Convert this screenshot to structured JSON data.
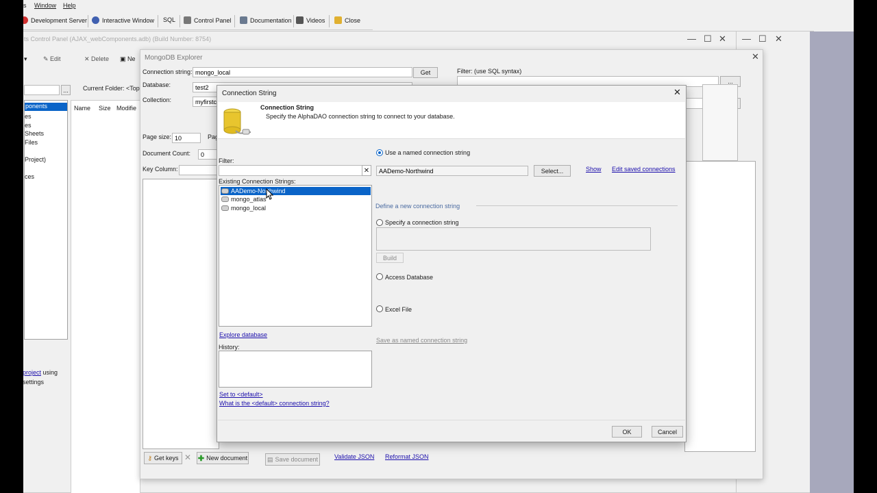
{
  "menubar": {
    "file_stub": "s",
    "window": "Window",
    "help": "Help"
  },
  "toolbar": {
    "items": [
      {
        "label": "Development Server",
        "color": "#d03030"
      },
      {
        "label": "Interactive Window",
        "color": "#4060b0"
      },
      {
        "label": "SQL"
      },
      {
        "label": "Control Panel"
      },
      {
        "label": "Documentation"
      },
      {
        "label": "Videos"
      },
      {
        "label": "Close"
      }
    ]
  },
  "control_panel": {
    "title": "ts Control Panel (AJAX_webComponents.adb) (Build Number: 8754)",
    "edit": "Edit",
    "delete": "Delete",
    "new_stub": "Ne",
    "current_folder": "Current Folder:  <Top",
    "browse": "...",
    "columns": [
      "Name",
      "Size",
      "Modifie"
    ],
    "tree": [
      "ponents",
      "es",
      "es",
      "Sheets",
      "Files",
      "Project)",
      "ces"
    ],
    "footer_link": "project",
    "footer_text1": " using",
    "footer_text2": "settings"
  },
  "mongo": {
    "title": "MongoDB Explorer",
    "conn_label": "Connection string:",
    "conn_value": "mongo_local",
    "get": "Get",
    "db_label": "Database:",
    "db_value": "test2",
    "coll_label": "Collection:",
    "coll_value": "myfirstcc",
    "filter_label": "Filter: (use SQL syntax)",
    "browse": "...",
    "page_size_label": "Page size:",
    "page_size_value": "10",
    "pag_stub": "Pag",
    "doc_count_label": "Document Count:",
    "doc_count_value": "0",
    "key_col_label": "Key Column:",
    "get_keys": "Get keys",
    "new_document": "New document",
    "save_document": "Save document",
    "validate_json": "Validate JSON",
    "reformat_json": "Reformat JSON"
  },
  "dialog": {
    "title": "Connection String",
    "header_title": "Connection String",
    "header_desc": "Specify the AlphaDAO connection string to connect to your database.",
    "filter_label": "Filter:",
    "existing_label": "Existing Connection Strings:",
    "connections": [
      "AADemo-Northwind",
      "mongo_atlas",
      "mongo_local"
    ],
    "explore_db": "Explore database",
    "history_label": "History:",
    "set_default": "Set to <default>",
    "what_default": "What is the <default> connection string?",
    "use_named": "Use a named connection string",
    "named_value": "AADemo-Northwind",
    "select_btn": "Select...",
    "show_link": "Show",
    "edit_saved": "Edit saved connections",
    "define_new": "Define a new connection string",
    "specify": "Specify a connection string",
    "build": "Build",
    "access_db": "Access Database",
    "excel_file": "Excel File",
    "save_named": "Save as named connection string",
    "ok": "OK",
    "cancel": "Cancel"
  },
  "colors": {
    "selection": "#0a64c8",
    "link": "#1a0dab",
    "right_panel": "#a7a8bc"
  }
}
